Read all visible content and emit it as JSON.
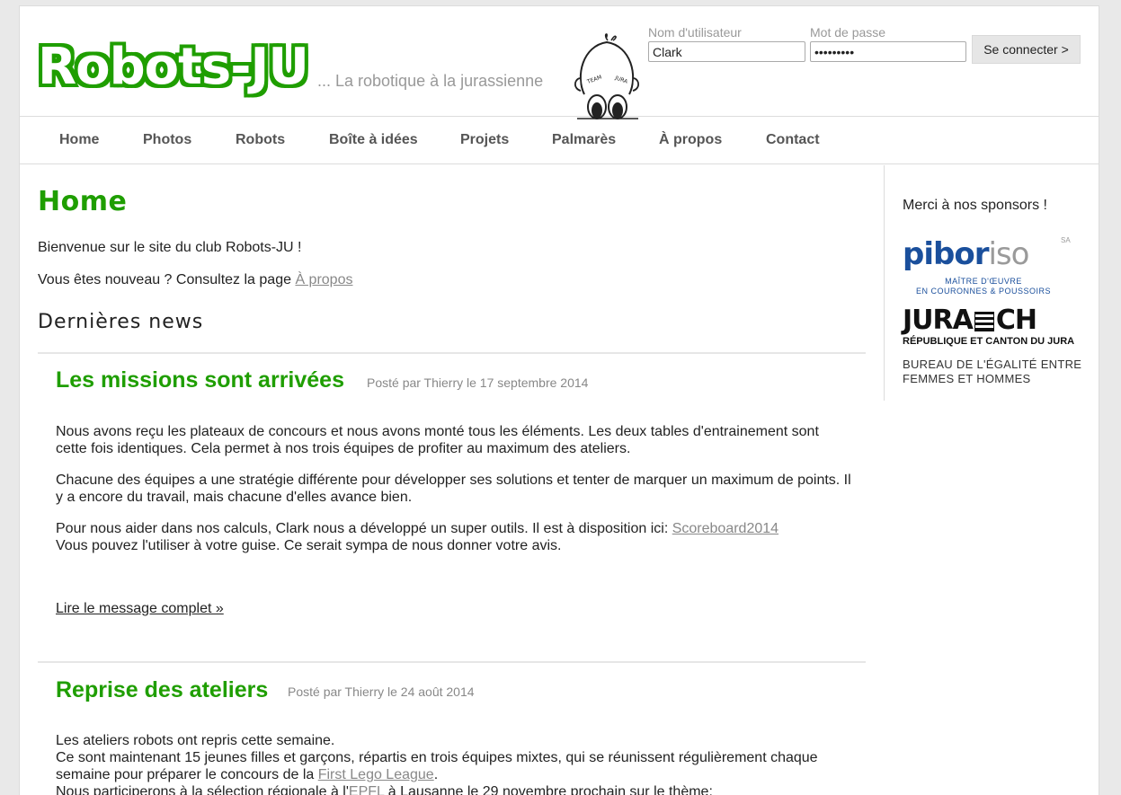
{
  "header": {
    "logo": "Robots-JU",
    "tagline": "... La robotique à la jurassienne",
    "mascot_text": "TEAM JURA"
  },
  "login": {
    "username_label": "Nom d'utilisateur",
    "username_value": "Clark",
    "password_label": "Mot de passe",
    "password_value": "•••••••••",
    "submit_label": "Se connecter >"
  },
  "nav": {
    "items": [
      "Home",
      "Photos",
      "Robots",
      "Boîte à idées",
      "Projets",
      "Palmarès",
      "À propos",
      "Contact"
    ]
  },
  "main": {
    "title": "Home",
    "welcome": "Bienvenue sur le site du club Robots-JU !",
    "new_prefix": "Vous êtes nouveau ? Consultez la page ",
    "new_link": "À propos",
    "news_heading": "Dernières news"
  },
  "posts": [
    {
      "title": "Les missions sont arrivées",
      "meta": "Posté par Thierry le 17 septembre 2014",
      "p1": "Nous avons reçu les plateaux de concours et nous avons monté tous les éléments. Les deux tables d'entrainement sont cette fois identiques. Cela permet à nos trois équipes de profiter au maximum des ateliers.",
      "p2": "Chacune des équipes a une stratégie différente pour développer ses solutions et tenter de marquer un maximum de points. Il y a encore du travail, mais chacune d'elles avance bien.",
      "p3_prefix": "Pour nous aider dans nos calculs, Clark nous a développé un super outils. Il est à disposition ici: ",
      "p3_link": "Scoreboard2014 ",
      "p3_line2": "Vous pouvez l'utiliser à votre guise. Ce serait sympa de nous donner votre avis.",
      "read_more": "Lire le message complet »"
    },
    {
      "title": "Reprise des ateliers",
      "meta": "Posté par Thierry le 24 août 2014",
      "line1": "Les ateliers robots ont repris cette semaine.",
      "line2": "Ce sont maintenant 15 jeunes filles et garçons, répartis en trois équipes mixtes, qui se réunissent régulièrement chaque",
      "line3_prefix": "semaine pour préparer le concours de la ",
      "line3_link": "First Lego League",
      "line3_suffix": ".",
      "line4_prefix": "Nous participerons à la sélection régionale à l'",
      "line4_link": "EPFL",
      "line4_suffix": " à Lausanne le 29 novembre prochain sur le thème:"
    }
  ],
  "sidebar": {
    "heading": "Merci à nos sponsors !",
    "sponsors": [
      {
        "name_part1": "pibor",
        "name_part2": "iso",
        "suffix": "SA",
        "line1": "MAÎTRE D'ŒUVRE",
        "line2": "EN COURONNES & POUSSOIRS",
        "colors": {
          "blue": "#1a4f9c",
          "gray": "#9a9a9a"
        }
      },
      {
        "name_part1": "JURA",
        "name_part2": "CH",
        "line1": "RÉPUBLIQUE ET CANTON DU JURA",
        "line2": "BUREAU DE L'ÉGALITÉ ENTRE",
        "line3": "FEMMES ET HOMMES"
      }
    ]
  },
  "colors": {
    "accent_green": "#1f9e00",
    "link_gray": "#888888",
    "nav_text": "#555555"
  }
}
